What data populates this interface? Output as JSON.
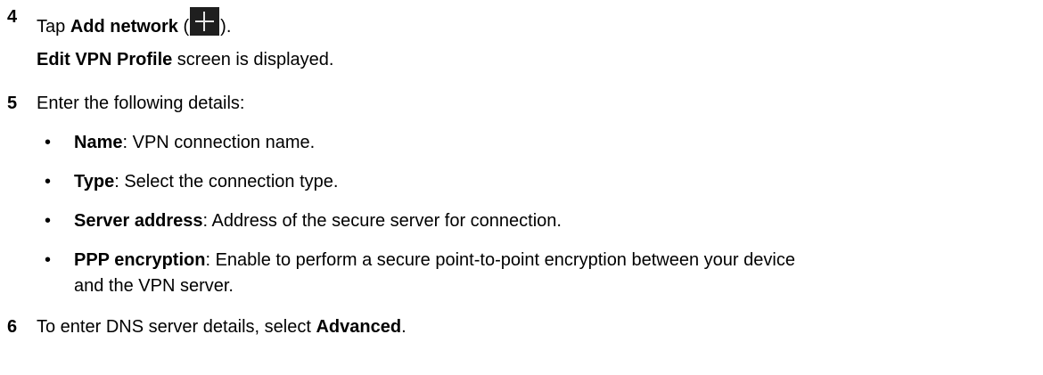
{
  "steps": [
    {
      "number": "4",
      "prefix": "Tap ",
      "bold": "Add network",
      "open_paren": " (",
      "icon": "plus-icon",
      "close_paren": ").",
      "result_bold": "Edit VPN Profile",
      "result_rest": " screen is displayed."
    },
    {
      "number": "5",
      "text": "Enter the following details:",
      "bullets": [
        {
          "label": "Name",
          "desc": ": VPN connection name."
        },
        {
          "label": "Type",
          "desc": ": Select the connection type."
        },
        {
          "label": "Server address",
          "desc": ": Address of the secure server for connection."
        },
        {
          "label": "PPP encryption",
          "desc": ": Enable to perform a secure point-to-point encryption between your device",
          "continuation": "and the VPN server."
        }
      ]
    },
    {
      "number": "6",
      "prefix": "To enter DNS server details, select ",
      "bold": "Advanced",
      "suffix": "."
    }
  ],
  "bullet_char": "•"
}
